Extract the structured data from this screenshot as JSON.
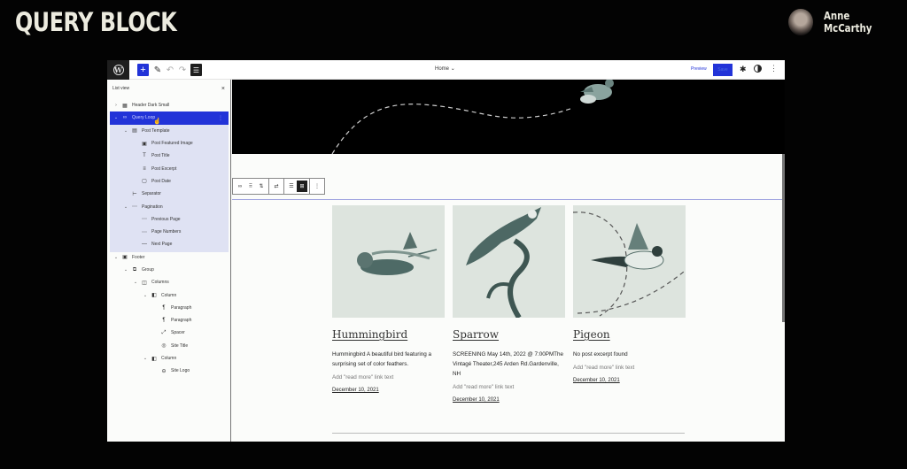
{
  "video": {
    "title": "QUERY BLOCK",
    "presenter": "Anne McCarthy"
  },
  "topbar": {
    "logo_glyph": "W",
    "add_glyph": "+",
    "edit_glyph": "✎",
    "undo_glyph": "↶",
    "redo_glyph": "↷",
    "listview_glyph": "☰",
    "document_title": "Home",
    "document_chevron": "⌄",
    "preview_label": "Preview",
    "save_label": "Save",
    "settings_glyph": "✱",
    "options_glyph": "⋮"
  },
  "list_view": {
    "title": "List view",
    "close_glyph": "×",
    "items": [
      {
        "label": "Header Dark Small",
        "icon": "▦",
        "toggle": "›",
        "level": 0
      },
      {
        "label": "Query Loop",
        "icon": "∞",
        "toggle": "⌄",
        "level": 0,
        "selected": true
      },
      {
        "label": "Post Template",
        "icon": "▤",
        "toggle": "⌄",
        "level": 1
      },
      {
        "label": "Post Featured Image",
        "icon": "▣",
        "toggle": "",
        "level": 2
      },
      {
        "label": "Post Title",
        "icon": "T",
        "toggle": "",
        "level": 2
      },
      {
        "label": "Post Excerpt",
        "icon": "≡",
        "toggle": "",
        "level": 2
      },
      {
        "label": "Post Date",
        "icon": "▢",
        "toggle": "",
        "level": 2
      },
      {
        "label": "Separator",
        "icon": "⊢",
        "toggle": "",
        "level": 1
      },
      {
        "label": "Pagination",
        "icon": "⋯",
        "toggle": "⌄",
        "level": 1
      },
      {
        "label": "Previous Page",
        "icon": "⋯",
        "toggle": "",
        "level": 2
      },
      {
        "label": "Page Numbers",
        "icon": "⋯",
        "toggle": "",
        "level": 2
      },
      {
        "label": "Next Page",
        "icon": "—",
        "toggle": "",
        "level": 2
      },
      {
        "label": "Footer",
        "icon": "▣",
        "toggle": "⌄",
        "level": 0
      },
      {
        "label": "Group",
        "icon": "⧉",
        "toggle": "⌄",
        "level": 1
      },
      {
        "label": "Columns",
        "icon": "◫",
        "toggle": "⌄",
        "level": 2
      },
      {
        "label": "Column",
        "icon": "◧",
        "toggle": "⌄",
        "level": 3
      },
      {
        "label": "Paragraph",
        "icon": "¶",
        "toggle": "",
        "level": 4
      },
      {
        "label": "Paragraph",
        "icon": "¶",
        "toggle": "",
        "level": 4
      },
      {
        "label": "Spacer",
        "icon": "⤢",
        "toggle": "",
        "level": 4
      },
      {
        "label": "Site Title",
        "icon": "◎",
        "toggle": "",
        "level": 4
      },
      {
        "label": "Column",
        "icon": "◧",
        "toggle": "⌄",
        "level": 3
      },
      {
        "label": "Site Logo",
        "icon": "⊖",
        "toggle": "",
        "level": 4
      }
    ]
  },
  "block_toolbar": {
    "groups": [
      [
        "∞",
        "⠿",
        "⇅"
      ],
      [
        "⇄"
      ],
      [
        "☰",
        "⊞"
      ],
      [
        "⋮"
      ]
    ]
  },
  "posts": [
    {
      "title": "Hummingbird",
      "excerpt": "Hummingbird A beautiful bird featuring a surprising set of color feathers.",
      "read_more": "Add \"read more\" link text",
      "date": "December 10, 2021"
    },
    {
      "title": "Sparrow",
      "excerpt": "SCREENING May 14th, 2022 @ 7:00PMThe Vintagé Theater,245 Arden Rd.Gardenville, NH",
      "read_more": "Add \"read more\" link text",
      "date": "December 10, 2021"
    },
    {
      "title": "Pigeon",
      "excerpt": "No post excerpt found",
      "read_more": "Add \"read more\" link text",
      "date": "December 10, 2021"
    }
  ],
  "colors": {
    "accent": "#2233d8",
    "selection_bg": "#dfe2f3"
  }
}
